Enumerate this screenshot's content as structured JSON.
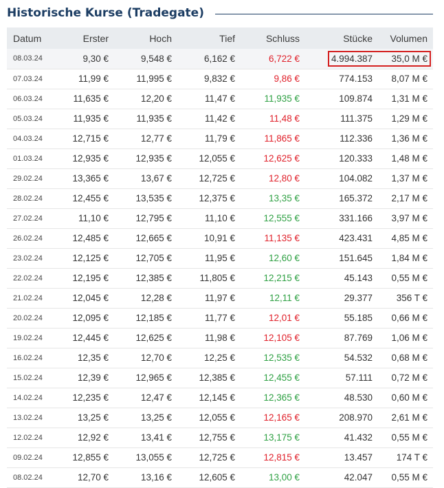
{
  "title": "Historische Kurse (Tradegate)",
  "columns": [
    "Datum",
    "Erster",
    "Hoch",
    "Tief",
    "Schluss",
    "Stücke",
    "Volumen"
  ],
  "colors": {
    "up": "#2ea043",
    "down": "#e0202a",
    "heading": "#1c3d63",
    "highlight": "#d42020"
  },
  "rows": [
    {
      "date": "08.03.24",
      "first": "9,30 €",
      "high": "9,548 €",
      "low": "6,162 €",
      "close": "6,722 €",
      "dir": "down",
      "pieces": "4.994.387",
      "volume": "35,0 M €"
    },
    {
      "date": "07.03.24",
      "first": "11,99 €",
      "high": "11,995 €",
      "low": "9,832 €",
      "close": "9,86 €",
      "dir": "down",
      "pieces": "774.153",
      "volume": "8,07 M €"
    },
    {
      "date": "06.03.24",
      "first": "11,635 €",
      "high": "12,20 €",
      "low": "11,47 €",
      "close": "11,935 €",
      "dir": "up",
      "pieces": "109.874",
      "volume": "1,31 M €"
    },
    {
      "date": "05.03.24",
      "first": "11,935 €",
      "high": "11,935 €",
      "low": "11,42 €",
      "close": "11,48 €",
      "dir": "down",
      "pieces": "111.375",
      "volume": "1,29 M €"
    },
    {
      "date": "04.03.24",
      "first": "12,715 €",
      "high": "12,77 €",
      "low": "11,79 €",
      "close": "11,865 €",
      "dir": "down",
      "pieces": "112.336",
      "volume": "1,36 M €"
    },
    {
      "date": "01.03.24",
      "first": "12,935 €",
      "high": "12,935 €",
      "low": "12,055 €",
      "close": "12,625 €",
      "dir": "down",
      "pieces": "120.333",
      "volume": "1,48 M €"
    },
    {
      "date": "29.02.24",
      "first": "13,365 €",
      "high": "13,67 €",
      "low": "12,725 €",
      "close": "12,80 €",
      "dir": "down",
      "pieces": "104.082",
      "volume": "1,37 M €"
    },
    {
      "date": "28.02.24",
      "first": "12,455 €",
      "high": "13,535 €",
      "low": "12,375 €",
      "close": "13,35 €",
      "dir": "up",
      "pieces": "165.372",
      "volume": "2,17 M €"
    },
    {
      "date": "27.02.24",
      "first": "11,10 €",
      "high": "12,795 €",
      "low": "11,10 €",
      "close": "12,555 €",
      "dir": "up",
      "pieces": "331.166",
      "volume": "3,97 M €"
    },
    {
      "date": "26.02.24",
      "first": "12,485 €",
      "high": "12,665 €",
      "low": "10,91 €",
      "close": "11,135 €",
      "dir": "down",
      "pieces": "423.431",
      "volume": "4,85 M €"
    },
    {
      "date": "23.02.24",
      "first": "12,125 €",
      "high": "12,705 €",
      "low": "11,95 €",
      "close": "12,60 €",
      "dir": "up",
      "pieces": "151.645",
      "volume": "1,84 M €"
    },
    {
      "date": "22.02.24",
      "first": "12,195 €",
      "high": "12,385 €",
      "low": "11,805 €",
      "close": "12,215 €",
      "dir": "up",
      "pieces": "45.143",
      "volume": "0,55 M €"
    },
    {
      "date": "21.02.24",
      "first": "12,045 €",
      "high": "12,28 €",
      "low": "11,97 €",
      "close": "12,11 €",
      "dir": "up",
      "pieces": "29.377",
      "volume": "356 T €"
    },
    {
      "date": "20.02.24",
      "first": "12,095 €",
      "high": "12,185 €",
      "low": "11,77 €",
      "close": "12,01 €",
      "dir": "down",
      "pieces": "55.185",
      "volume": "0,66 M €"
    },
    {
      "date": "19.02.24",
      "first": "12,445 €",
      "high": "12,625 €",
      "low": "11,98 €",
      "close": "12,105 €",
      "dir": "down",
      "pieces": "87.769",
      "volume": "1,06 M €"
    },
    {
      "date": "16.02.24",
      "first": "12,35 €",
      "high": "12,70 €",
      "low": "12,25 €",
      "close": "12,535 €",
      "dir": "up",
      "pieces": "54.532",
      "volume": "0,68 M €"
    },
    {
      "date": "15.02.24",
      "first": "12,39 €",
      "high": "12,965 €",
      "low": "12,385 €",
      "close": "12,455 €",
      "dir": "up",
      "pieces": "57.111",
      "volume": "0,72 M €"
    },
    {
      "date": "14.02.24",
      "first": "12,235 €",
      "high": "12,47 €",
      "low": "12,145 €",
      "close": "12,365 €",
      "dir": "up",
      "pieces": "48.530",
      "volume": "0,60 M €"
    },
    {
      "date": "13.02.24",
      "first": "13,25 €",
      "high": "13,25 €",
      "low": "12,055 €",
      "close": "12,165 €",
      "dir": "down",
      "pieces": "208.970",
      "volume": "2,61 M €"
    },
    {
      "date": "12.02.24",
      "first": "12,92 €",
      "high": "13,41 €",
      "low": "12,755 €",
      "close": "13,175 €",
      "dir": "up",
      "pieces": "41.432",
      "volume": "0,55 M €"
    },
    {
      "date": "09.02.24",
      "first": "12,855 €",
      "high": "13,055 €",
      "low": "12,725 €",
      "close": "12,815 €",
      "dir": "down",
      "pieces": "13.457",
      "volume": "174 T €"
    },
    {
      "date": "08.02.24",
      "first": "12,70 €",
      "high": "13,16 €",
      "low": "12,605 €",
      "close": "13,00 €",
      "dir": "up",
      "pieces": "42.047",
      "volume": "0,55 M €"
    }
  ]
}
